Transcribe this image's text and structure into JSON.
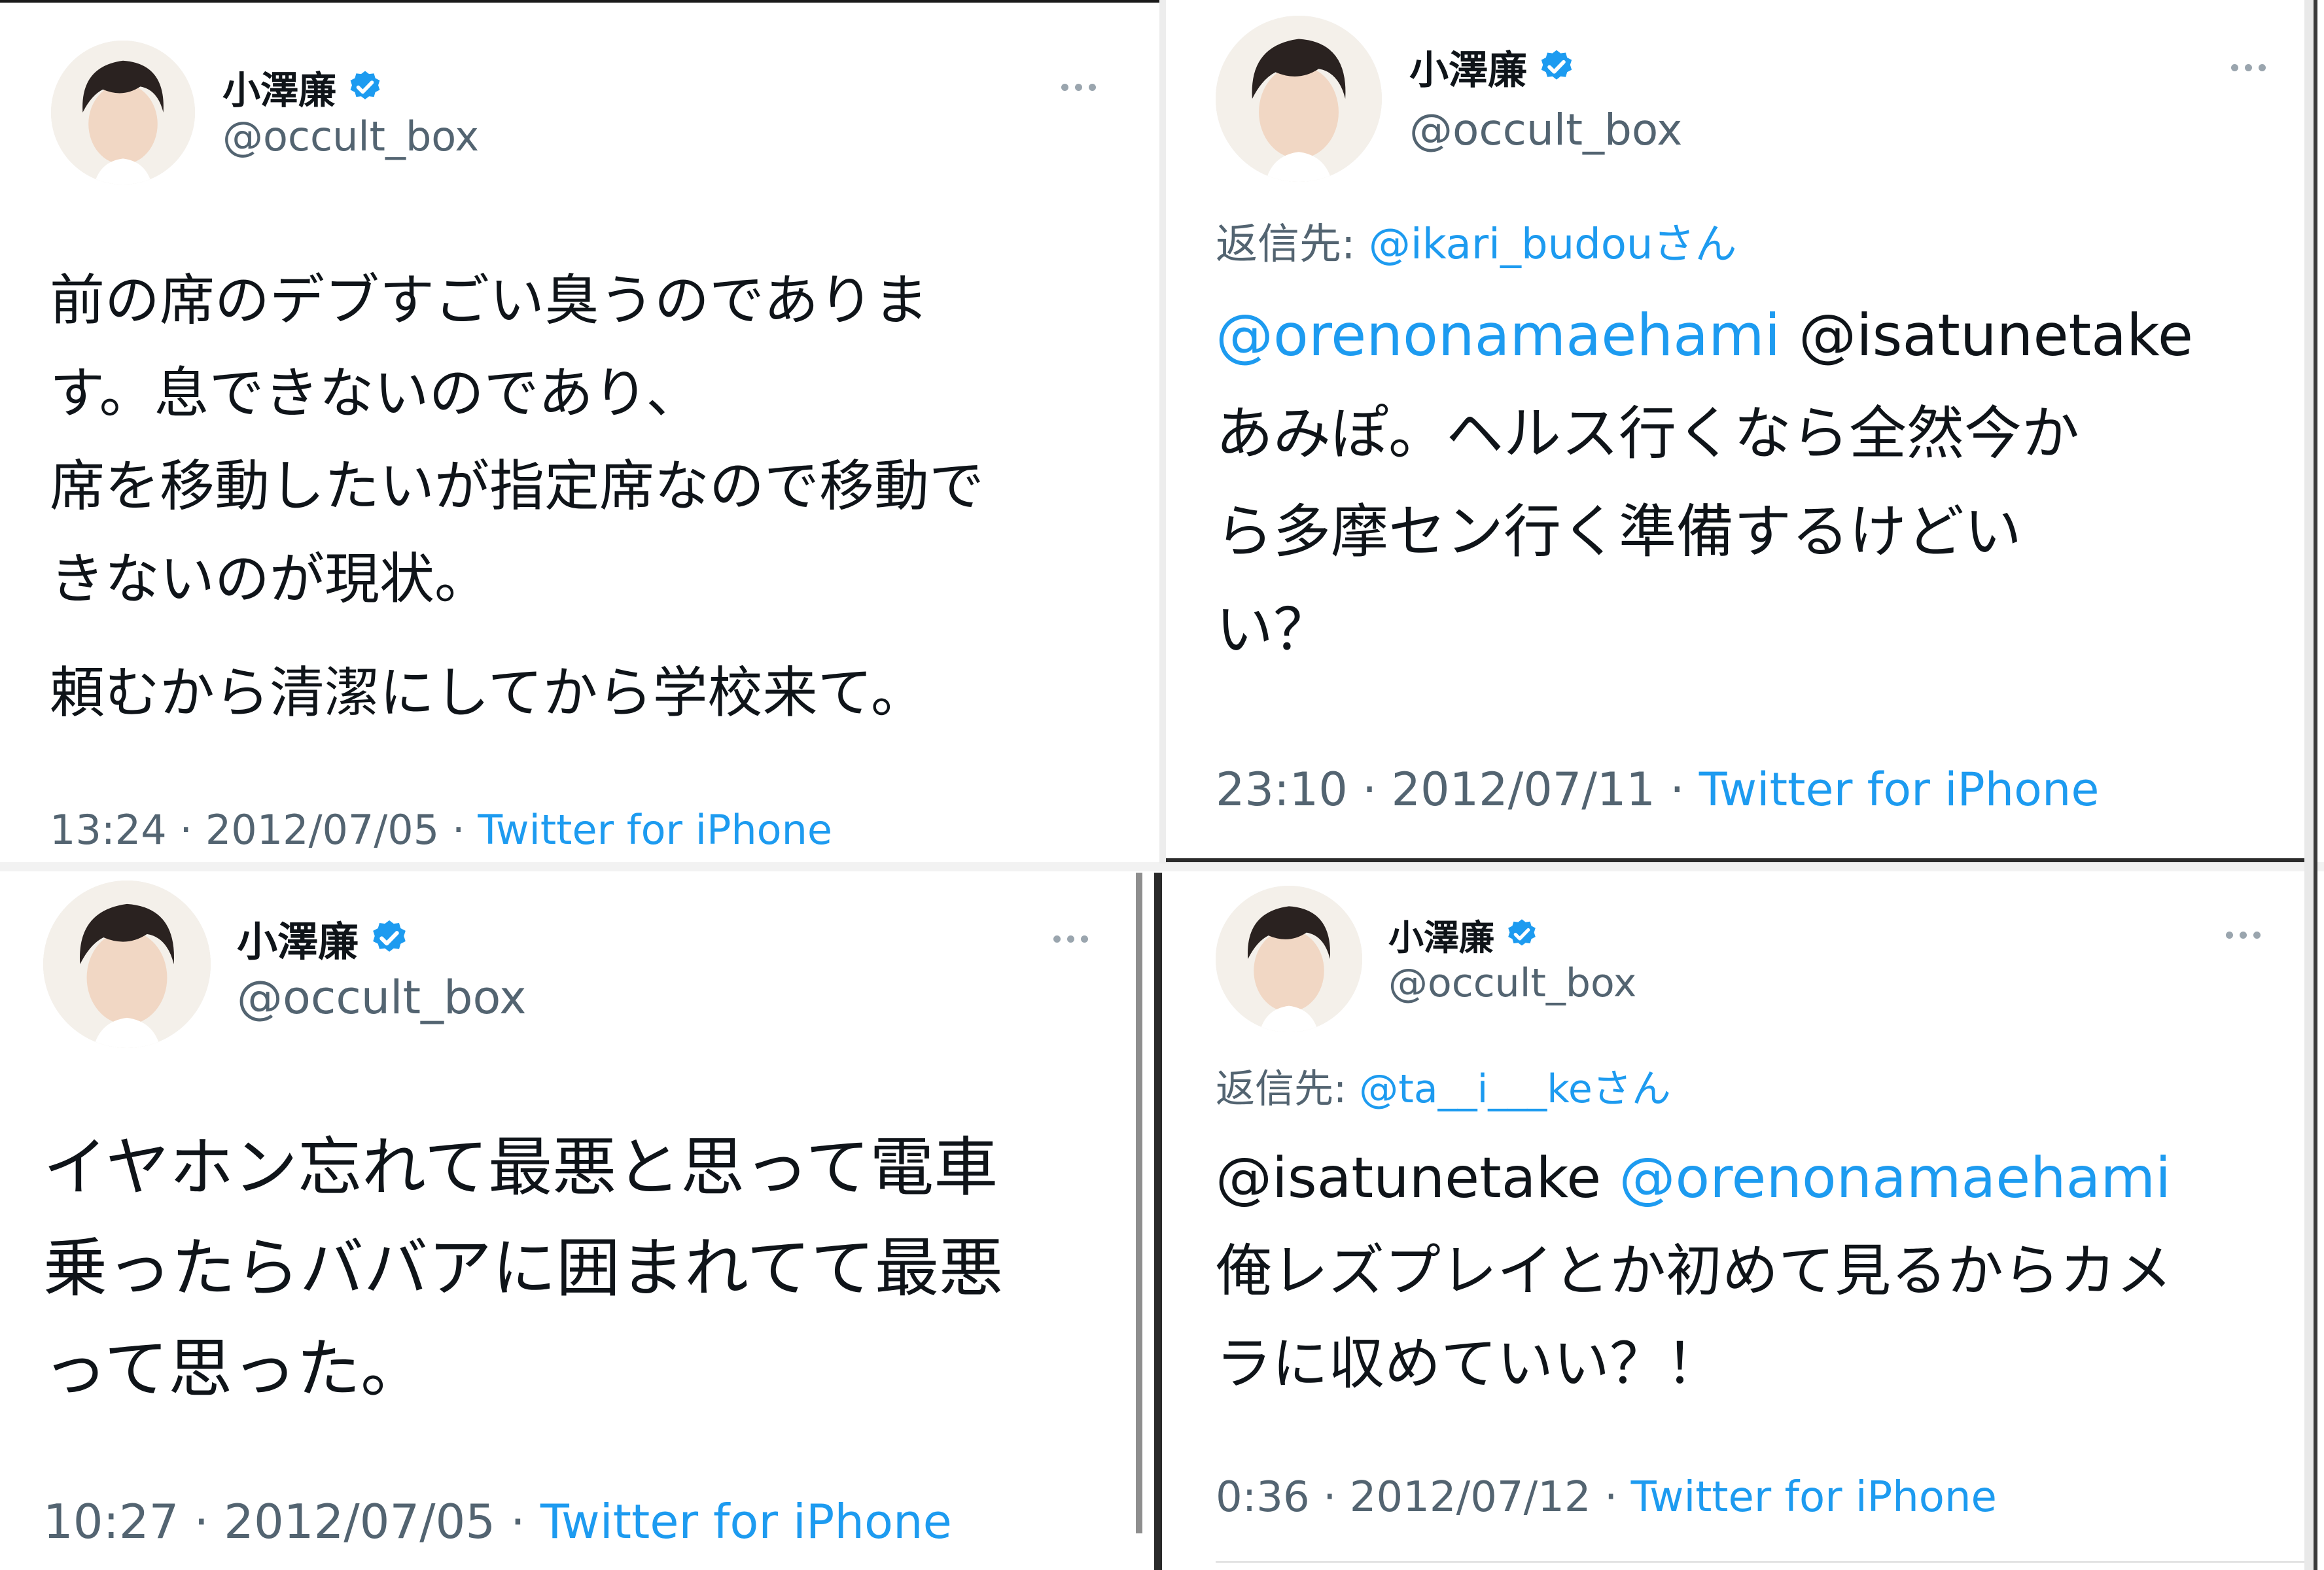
{
  "tweets": [
    {
      "name": "小澤廉",
      "handle": "@occult_box",
      "reply_to": null,
      "text_lines": [
        "前の席のデブすごい臭うのでありま",
        "す。息できないのであり、",
        "席を移動したいが指定席なので移動で",
        "きないのが現状。",
        "頼むから清潔にしてから学校来て。"
      ],
      "time": "13:24",
      "date": "2012/07/05",
      "source": "Twitter for iPhone"
    },
    {
      "name": "小澤廉",
      "handle": "@occult_box",
      "reply_label": "返信先: ",
      "reply_handle": "@ikari_budou",
      "reply_suffix": "さん",
      "mention_blue": "@orenonamaehami",
      "mention_plain": " @isatunetake",
      "text_lines": [
        "あみぽ。ヘルス行くなら全然今か",
        "ら多摩セン行く準備するけどい",
        "い？"
      ],
      "time": "23:10",
      "date": "2012/07/11",
      "source": "Twitter for iPhone"
    },
    {
      "name": "小澤廉",
      "handle": "@occult_box",
      "text_lines": [
        "イヤホン忘れて最悪と思って電車",
        "乗ったらババアに囲まれてて最悪",
        "って思った。"
      ],
      "time": "10:27",
      "date": "2012/07/05",
      "source": "Twitter for iPhone"
    },
    {
      "name": "小澤廉",
      "handle": "@occult_box",
      "reply_label": "返信先: ",
      "reply_handle": "@ta__i___ke",
      "reply_suffix": "さん",
      "mention_plain": "@isatunetake ",
      "mention_blue": "@orenonamaehami",
      "text_lines": [
        "俺レズプレイとか初めて見るからカメ",
        "ラに収めていい？！"
      ],
      "time": "0:36",
      "date": "2012/07/12",
      "source": "Twitter for iPhone"
    }
  ],
  "separator": " · ",
  "colors": {
    "link": "#1d9bf0",
    "text": "#0f1419",
    "muted": "#536471",
    "verified": "#1d9bf0"
  },
  "icons": {
    "verified": "verified-badge-icon",
    "more": "more-options-icon"
  }
}
